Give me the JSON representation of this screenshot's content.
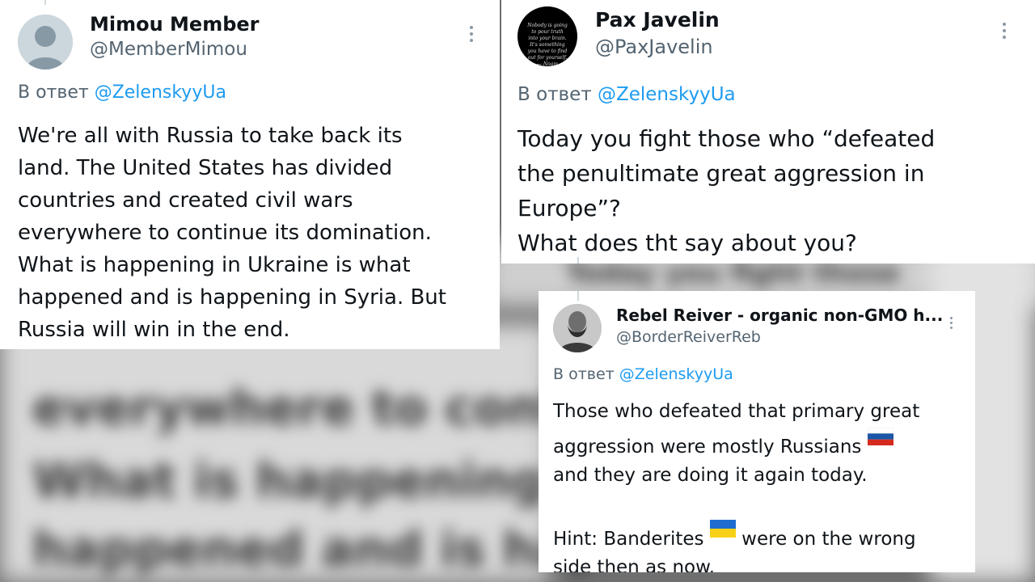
{
  "tweets": [
    {
      "name": "Mimou Member",
      "handle": "@MemberMimou",
      "reply_prefix": "В ответ",
      "reply_mention": "@ZelenskyyUa",
      "text": "We're all with Russia to take back its\nland. The United States has divided\ncountries and created civil wars\neverywhere to continue its domination.\nWhat is happening in Ukraine is what\nhappened and is happening in Syria. But\nRussia will win in the end."
    },
    {
      "name": "Pax Javelin",
      "handle": "@PaxJavelin",
      "reply_prefix": "В ответ",
      "reply_mention": "@ZelenskyyUa",
      "avatar_text": "Nobody is going to pour truth into your brain. It's something you have to find out for yourself. — Noam Chomsky",
      "text": "Today you fight those who “defeated\nthe penultimate great aggression in\nEurope”?\nWhat does tht say about you?"
    },
    {
      "name": "Rebel Reiver - organic non-GMO h...",
      "handle": "@BorderReiverReb",
      "reply_prefix": "В ответ",
      "reply_mention": "@ZelenskyyUa",
      "text_line1": "Those who defeated that primary great",
      "text_line2": "aggression were mostly Russians",
      "text_line3": "and they are doing it again today.",
      "text_line4_a": "Hint: Banderites",
      "text_line4_b": "were on the wrong",
      "text_line5": "side then as now."
    }
  ],
  "icons": {
    "more": "more-options-icon",
    "flag_ru": "russia-flag-icon",
    "flag_ua": "ukraine-flag-icon"
  },
  "colors": {
    "mention": "#1d9bf0",
    "secondary_text": "#536471"
  }
}
